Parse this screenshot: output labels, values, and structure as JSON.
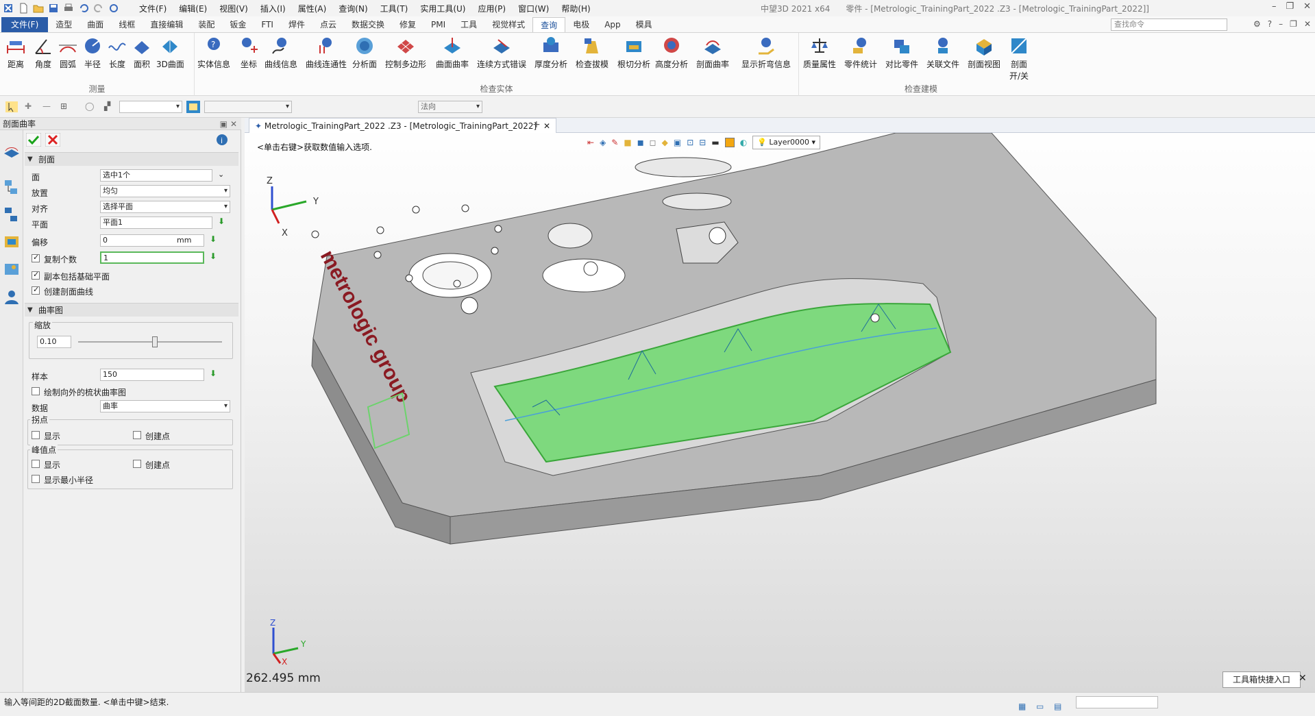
{
  "app": {
    "title_left": "中望3D 2021 x64",
    "title_main": "零件 - [Metrologic_TrainingPart_2022 .Z3 - [Metrologic_TrainingPart_2022]]"
  },
  "menu": [
    "文件(F)",
    "编辑(E)",
    "视图(V)",
    "插入(I)",
    "属性(A)",
    "查询(N)",
    "工具(T)",
    "实用工具(U)",
    "应用(P)",
    "窗口(W)",
    "帮助(H)"
  ],
  "ribbon_tabs": [
    "文件(F)",
    "造型",
    "曲面",
    "线框",
    "直接编辑",
    "装配",
    "钣金",
    "FTI",
    "焊件",
    "点云",
    "数据交换",
    "修复",
    "PMI",
    "工具",
    "视觉样式",
    "查询",
    "电极",
    "App",
    "模具"
  ],
  "active_tab": "查询",
  "search_placeholder": "查找命令",
  "groups": {
    "measure": {
      "label": "测量",
      "buttons": [
        "距离",
        "角度",
        "圆弧",
        "半径",
        "长度",
        "面积",
        "3D曲面"
      ]
    },
    "inspect": {
      "label": "检查实体",
      "buttons": [
        "实体信息",
        "坐标",
        "曲线信息",
        "曲线连通性",
        "分析面",
        "控制多边形",
        "曲面曲率",
        "连续方式错误",
        "厚度分析",
        "检查拔模",
        "根切分析",
        "高度分析",
        "剖面曲率",
        "显示折弯信息"
      ]
    },
    "model": {
      "label": "检查建模",
      "buttons": [
        "质量属性",
        "零件统计",
        "对比零件",
        "关联文件",
        "剖面视图",
        "剖面 开/关"
      ]
    }
  },
  "toolbar2": {
    "filter_value": "法向"
  },
  "panel": {
    "title": "剖面曲率",
    "section1": "剖面",
    "fields": {
      "face_label": "面",
      "face_value": "选中1个",
      "place_label": "放置",
      "place_value": "均匀",
      "align_label": "对齐",
      "align_value": "选择平面",
      "plane_label": "平面",
      "plane_value": "平面1",
      "offset_label": "偏移",
      "offset_value": "0",
      "offset_unit": "mm",
      "copies_label": "复制个数",
      "copies_value": "1"
    },
    "check_base": "副本包括基础平面",
    "check_create": "创建剖面曲线",
    "section2": "曲率图",
    "scale_label": "缩放",
    "scale_value": "0.10",
    "sample_label": "样本",
    "sample_value": "150",
    "outward_label": "绘制向外的梳状曲率图",
    "data_label": "数据",
    "data_value": "曲率",
    "inflect_label": "拐点",
    "peak_label": "峰值点",
    "show_label": "显示",
    "create_pt_label": "创建点",
    "minr_label": "显示最小半径"
  },
  "viewport": {
    "doc_tab": "Metrologic_TrainingPart_2022 .Z3 - [Metrologic_TrainingPart_2022]",
    "prompt": "<单击右键>获取数值输入选项.",
    "layer": "Layer0000",
    "distance": "262.495 mm",
    "logo_text": "metrologic group",
    "axis_x": "X",
    "axis_y": "Y",
    "axis_z": "Z"
  },
  "status": {
    "text": "输入等间距的2D截面数量. <单击中键>结束.",
    "quick_entry": "工具箱快捷入口"
  },
  "colors": {
    "accent": "#2a5ca8",
    "curvature_fill": "#7ed97e"
  }
}
